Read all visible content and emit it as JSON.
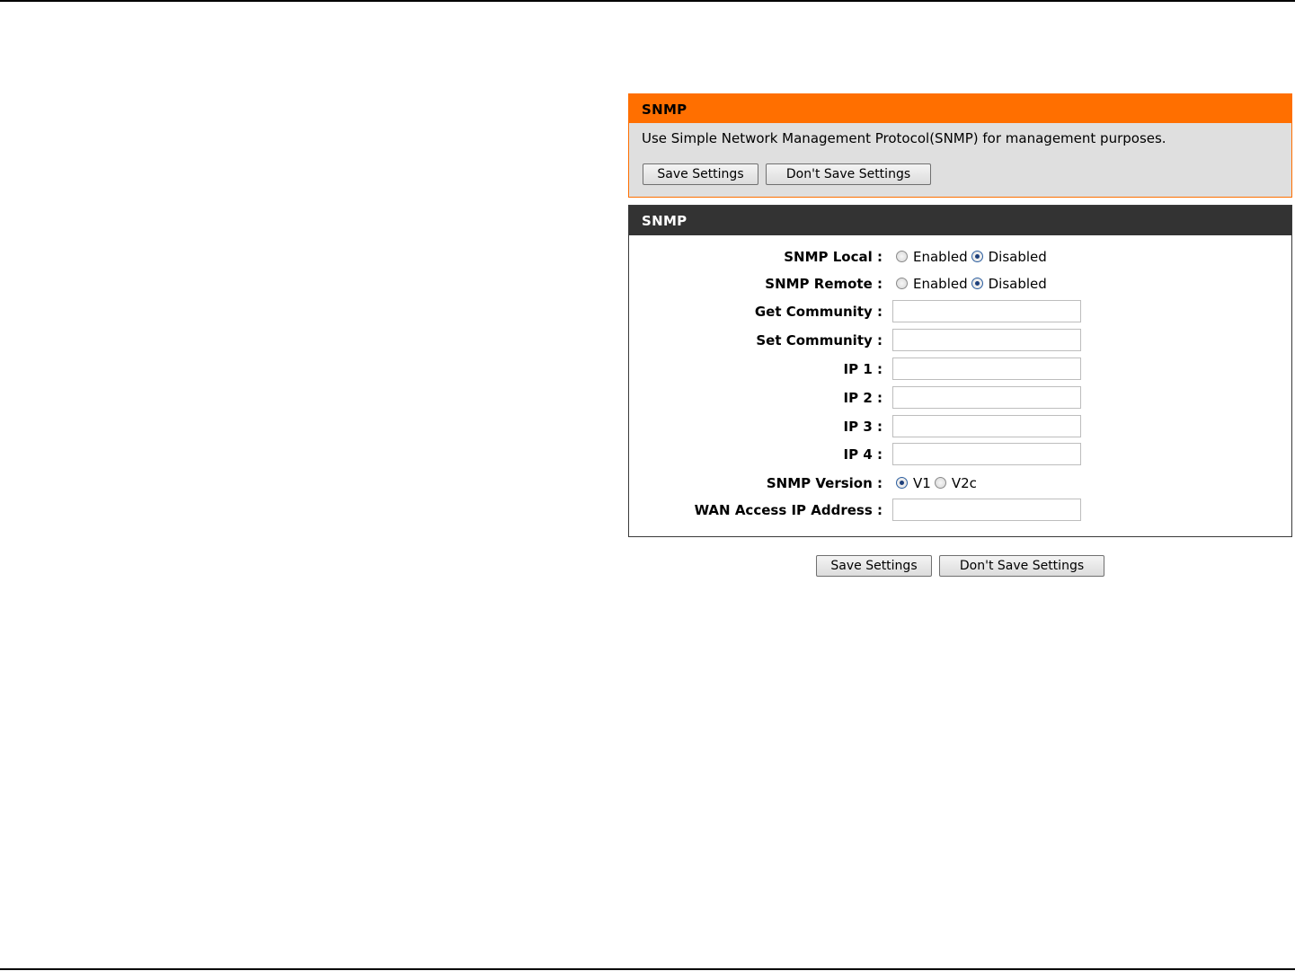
{
  "intro": {
    "title": "SNMP",
    "description": "Use Simple Network Management Protocol(SNMP) for management purposes.",
    "save_label": "Save Settings",
    "dont_save_label": "Don't Save Settings"
  },
  "settings": {
    "title": "SNMP",
    "snmp_local": {
      "label": "SNMP Local :",
      "option_enabled": "Enabled",
      "option_disabled": "Disabled",
      "selected": "Disabled"
    },
    "snmp_remote": {
      "label": "SNMP Remote :",
      "option_enabled": "Enabled",
      "option_disabled": "Disabled",
      "selected": "Disabled"
    },
    "get_community": {
      "label": "Get Community :",
      "value": ""
    },
    "set_community": {
      "label": "Set Community :",
      "value": ""
    },
    "ip1": {
      "label": "IP 1 :",
      "value": ""
    },
    "ip2": {
      "label": "IP 2 :",
      "value": ""
    },
    "ip3": {
      "label": "IP 3 :",
      "value": ""
    },
    "ip4": {
      "label": "IP 4 :",
      "value": ""
    },
    "snmp_version": {
      "label": "SNMP Version :",
      "option_v1": "V1",
      "option_v2c": "V2c",
      "selected": "V1"
    },
    "wan_access_ip": {
      "label": "WAN Access IP Address :",
      "value": ""
    }
  },
  "footer": {
    "save_label": "Save Settings",
    "dont_save_label": "Don't Save Settings"
  }
}
